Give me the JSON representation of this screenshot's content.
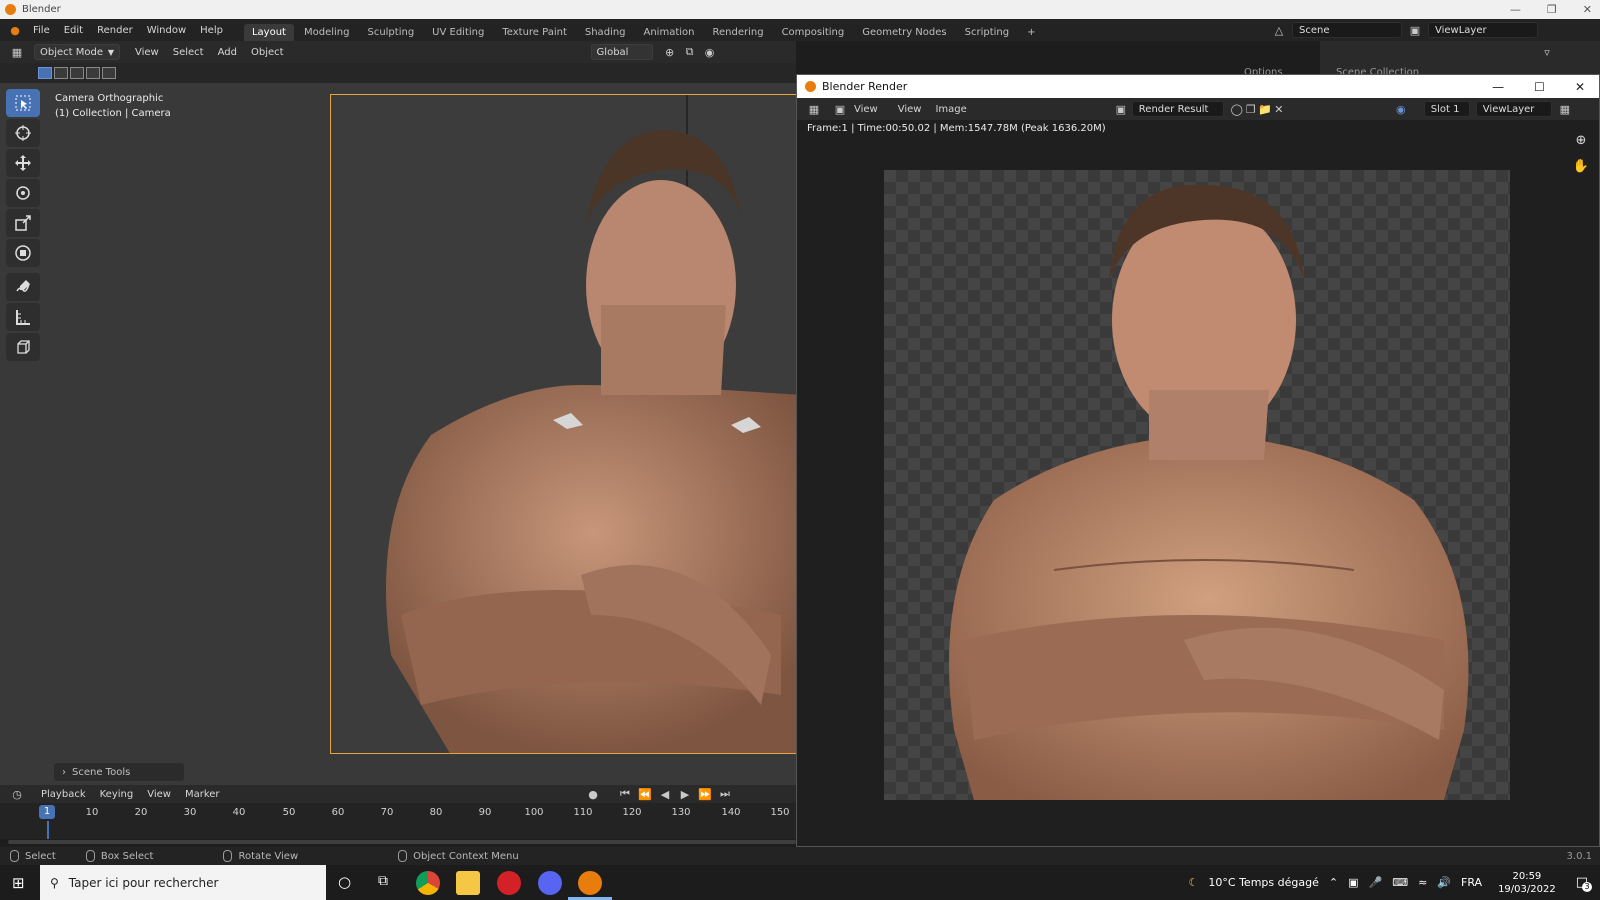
{
  "os_window": {
    "title": "Blender"
  },
  "menu": [
    "File",
    "Edit",
    "Render",
    "Window",
    "Help"
  ],
  "workspaces": [
    "Layout",
    "Modeling",
    "Sculpting",
    "UV Editing",
    "Texture Paint",
    "Shading",
    "Animation",
    "Rendering",
    "Compositing",
    "Geometry Nodes",
    "Scripting",
    "+"
  ],
  "scene": {
    "name": "Scene",
    "view_layer": "ViewLayer"
  },
  "viewport_header": {
    "mode": "Object Mode",
    "menus": [
      "View",
      "Select",
      "Add",
      "Object"
    ],
    "transform_orientation": "Global"
  },
  "right_panel": {
    "options_label": "Options",
    "scene_collection": "Scene Collection"
  },
  "camera_info": {
    "line1": "Camera Orthographic",
    "line2": "(1) Collection | Camera"
  },
  "scene_tools": "Scene Tools",
  "timeline": {
    "menus": [
      "Playback",
      "Keying",
      "View",
      "Marker"
    ],
    "current_frame": "1",
    "ticks": [
      "10",
      "20",
      "30",
      "40",
      "50",
      "60",
      "70",
      "80",
      "90",
      "100",
      "110",
      "120",
      "130",
      "140",
      "150"
    ]
  },
  "status_bar": {
    "items": [
      "Select",
      "Box Select",
      "Rotate View",
      "Object Context Menu"
    ],
    "version": "3.0.1"
  },
  "render_window": {
    "title": "Blender Render",
    "menus": [
      "View",
      "View",
      "Image"
    ],
    "image_name": "Render Result",
    "slot": "Slot 1",
    "view_layer": "ViewLayer",
    "stats": "Frame:1 | Time:00:50.02 | Mem:1547.78M (Peak 1636.20M)"
  },
  "taskbar": {
    "search_placeholder": "Taper ici pour rechercher",
    "weather": "10°C  Temps dégagé",
    "lang": "FRA",
    "time": "20:59",
    "date": "19/03/2022",
    "notif_count": "3"
  },
  "colors": {
    "accent": "#4772b3",
    "camera_frame": "#e8a33a",
    "blender_orange": "#e87d0d"
  }
}
